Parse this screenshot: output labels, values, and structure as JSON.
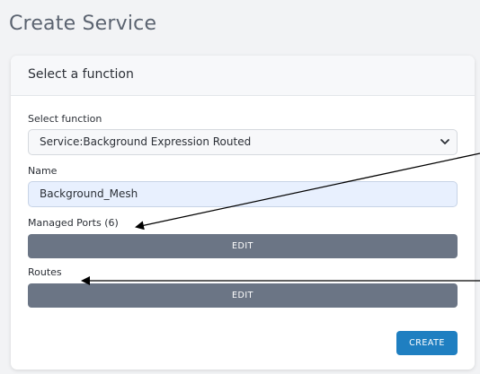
{
  "page": {
    "title": "Create Service"
  },
  "card": {
    "header_title": "Select a function",
    "function_field": {
      "label": "Select function",
      "selected": "Service:Background Expression Routed"
    },
    "name_field": {
      "label": "Name",
      "value": "Background_Mesh"
    },
    "managed_ports": {
      "label": "Managed Ports (6)",
      "button_label": "EDIT"
    },
    "routes": {
      "label": "Routes",
      "button_label": "EDIT"
    },
    "create_button_label": "CREATE"
  },
  "colors": {
    "edit_button": "#6b7585",
    "create_button": "#1f7fc1",
    "name_input_bg": "#e8f0fe",
    "annotation_arrow": "#000000"
  },
  "icons": {
    "select_chevron": "chevron-down-icon"
  }
}
